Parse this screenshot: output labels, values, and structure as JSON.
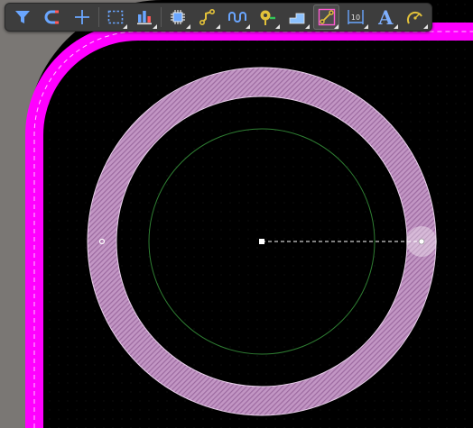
{
  "toolbar": {
    "items": [
      {
        "name": "filter-tool",
        "icon": "filter-icon",
        "dropdown": false
      },
      {
        "name": "snap-tool",
        "icon": "magnet-icon",
        "dropdown": false
      },
      {
        "name": "crosshair-tool",
        "icon": "crosshair-icon",
        "dropdown": false
      },
      {
        "name": "select-tool",
        "icon": "selection-rect-icon",
        "dropdown": true
      },
      {
        "name": "align-tool",
        "icon": "align-icon",
        "dropdown": true
      },
      {
        "name": "component-tool",
        "icon": "component-icon",
        "dropdown": true
      },
      {
        "name": "route-tool",
        "icon": "route-icon",
        "dropdown": true
      },
      {
        "name": "tune-tool",
        "icon": "tune-icon",
        "dropdown": true
      },
      {
        "name": "via-tool",
        "icon": "via-icon",
        "dropdown": true
      },
      {
        "name": "fill-tool",
        "icon": "fill-icon",
        "dropdown": true
      },
      {
        "name": "track-tool",
        "icon": "track-icon",
        "dropdown": true
      },
      {
        "name": "dimension-tool",
        "icon": "dimension-icon",
        "dropdown": true
      },
      {
        "name": "text-tool",
        "icon": "text-icon",
        "label": "A",
        "dropdown": true
      },
      {
        "name": "arc-tool",
        "icon": "arc-icon",
        "dropdown": true
      }
    ]
  },
  "colors": {
    "background": "#000000",
    "outside_board": "#7a7774",
    "board_outline": "#ff00ff",
    "pad_ring": "#c89ac8",
    "inner_circle": "#2e7d32",
    "toolbar_bg": "#3d3d3d",
    "icon_blue": "#6aa6ff",
    "icon_yellow": "#e3c23a"
  }
}
